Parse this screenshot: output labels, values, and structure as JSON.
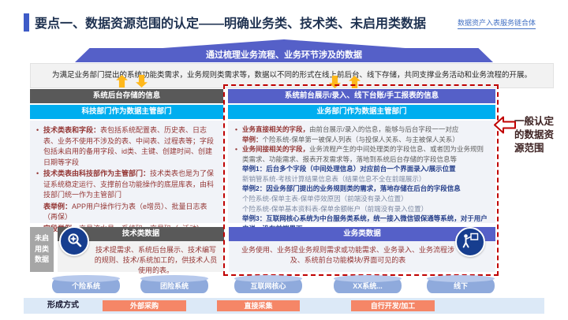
{
  "header": {
    "title": "要点一、数据资源范围的认定——明确业务类、技术类、未启用类数据",
    "brand": "数据资产入表服务链合体"
  },
  "banner": "通过梳理业务流程、业务环节涉及的数据",
  "intro": "为满足业务部门提出的系统功能类需求，业务规则类需求等，数据以不同的形式在线上前后台、线下存储，共同支撑业务活动和业务流程的开展。",
  "left_panel": {
    "header": "系统后台存储的信息",
    "subheader": "科技部门作为数据主管部门",
    "items": [
      {
        "lead": "技术类表和字段：",
        "text": "表包括系统配置表、历史表、日志表、业务不使用不涉及的表、中间表、过程表等；字段包括未启用的备用字段、id类、主键、创建时间、创建日期等字段"
      },
      {
        "lead": "技术类表由科技部作为主管部门：",
        "text": "技术类表也是为了保证系统稳定运行、支撑前台功能操作的底层库表，由科技部门统一作为主管部门"
      },
      {
        "lead": "表举例：",
        "text": "APP用户操作行为表（e增员）、批量日志表（再保）"
      },
      {
        "lead": "字段举例：",
        "text": "交易流水号、系统码、交易码（e活动）"
      }
    ]
  },
  "right_panel": {
    "header": "系统前台展示/录入、线下台账/手工报表的信息",
    "subheader": "业务部门作为数据主管部门",
    "lines": [
      {
        "lead": "业务直接相关的字段，",
        "text": "由前台展示/录入的信息，能够与后台字段一一对应"
      },
      {
        "lead": "举例：",
        "text": "个险系统-保单第一被保人列表（与投保人关系、与主被保人关系）"
      },
      {
        "lead": "业务间接相关的字段，",
        "text": "业务流程产生的中间处理类的字段信息、或者因为业务规则类需求、功能需求、报表开发需求等，落地到系统后台存储的字段信息等"
      },
      {
        "lead": "举例1：",
        "text": "后台多个字段（中间处理信息）对应前台一个界面录入/展示位置"
      },
      {
        "lead": "",
        "text": "新销管系统-考核计算结果信息表（结果信息不全在前端展示）"
      },
      {
        "lead": "举例2：",
        "text": "因业务部门提出的业务规则类的需求，落地存储在后台的字段信息"
      },
      {
        "lead": "",
        "text": "个险系统-保单主表-保单停效原因（前端没有录入位置）"
      },
      {
        "lead": "",
        "text": "个险系统-保单基本资料表-保单余额帐户（前端没有录入位置）"
      },
      {
        "lead": "举例3：",
        "text": "互联网核心系统为中台服务类系统，统一接入微信银保通等系统，对于用户来说，没有前端界面"
      }
    ]
  },
  "annotation": "一般认定的数据资源范围",
  "bottom": {
    "side_label": "未启用类数据",
    "tech": {
      "title": "技术类数据",
      "icon": "gear-search-icon",
      "text": "技术提需求、系统后台展示、技术编写的规则、技术/系统加工的，供技术人员使用的表。"
    },
    "biz": {
      "title": "业务类数据",
      "icon": "presenter-icon",
      "text": "业务使用、业务提业务规则需求或功能需求、业务录入、业务流程涉及、系统前台功能模块/界面可见的表"
    }
  },
  "systems": [
    "个险系统",
    "团险系统",
    "互联网核心",
    "XX系统...",
    "线下"
  ],
  "formation": {
    "label": "形成方式",
    "methods": [
      "外部采购",
      "直接采集",
      "自行开发/加工"
    ]
  },
  "colors": {
    "accent": "#3E5BC7",
    "banner_purple": "#5560C8",
    "cyan": "#00AEEF",
    "dark_gray": "#595959",
    "maroon": "#943634",
    "red": "#C00000",
    "orange": "#FFB81C",
    "cylinder_blue": "#8FAADC",
    "salmon": "#F58667"
  }
}
